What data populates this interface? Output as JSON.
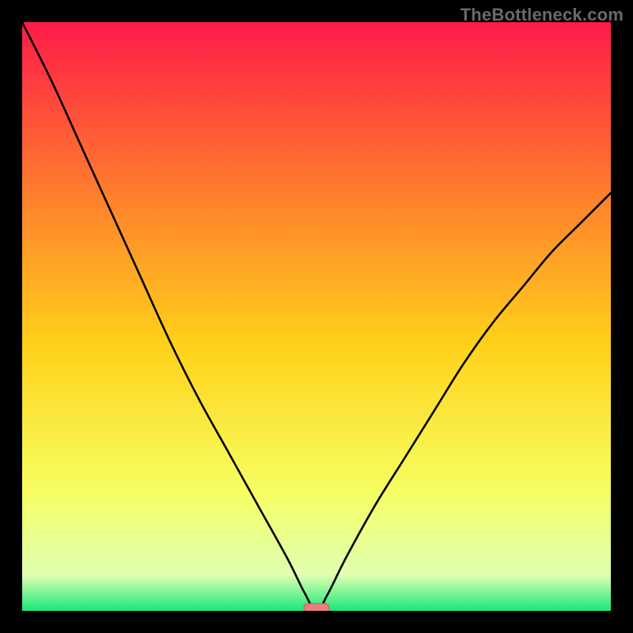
{
  "watermark": "TheBottleneck.com",
  "colors": {
    "frame": "#000000",
    "curve": "#000000",
    "marker_fill": "#e77f7d",
    "marker_stroke": "#d35b59",
    "gradient": {
      "top": "#ff1a49",
      "upper_mid": "#ff7a2e",
      "mid": "#ffd21a",
      "lower_mid": "#f6ff63",
      "near_bottom": "#dfffb2",
      "bottom": "#17e87a"
    }
  },
  "chart_data": {
    "type": "line",
    "title": "",
    "xlabel": "",
    "ylabel": "",
    "xlim": [
      0,
      100
    ],
    "ylim": [
      0,
      100
    ],
    "grid": false,
    "legend": false,
    "series": [
      {
        "name": "bottleneck-curve",
        "x": [
          0,
          5,
          10,
          15,
          20,
          25,
          30,
          35,
          40,
          45,
          48,
          50,
          52,
          55,
          60,
          65,
          70,
          75,
          80,
          85,
          90,
          95,
          100
        ],
        "y": [
          100,
          90,
          79,
          68,
          57,
          46,
          36,
          27,
          18,
          9,
          3,
          0,
          3,
          9,
          18,
          26,
          34,
          42,
          49,
          55,
          61,
          66,
          71
        ]
      }
    ],
    "markers": [
      {
        "name": "optimal-marker",
        "x": 50,
        "y": 0.5,
        "shape": "roundrect"
      }
    ],
    "notes": "V-shaped bottleneck curve over a vertical heat gradient; minimum at x≈50 touching y≈0; left branch reaches y=100 at x=0; right branch reaches y≈71 at x=100"
  }
}
